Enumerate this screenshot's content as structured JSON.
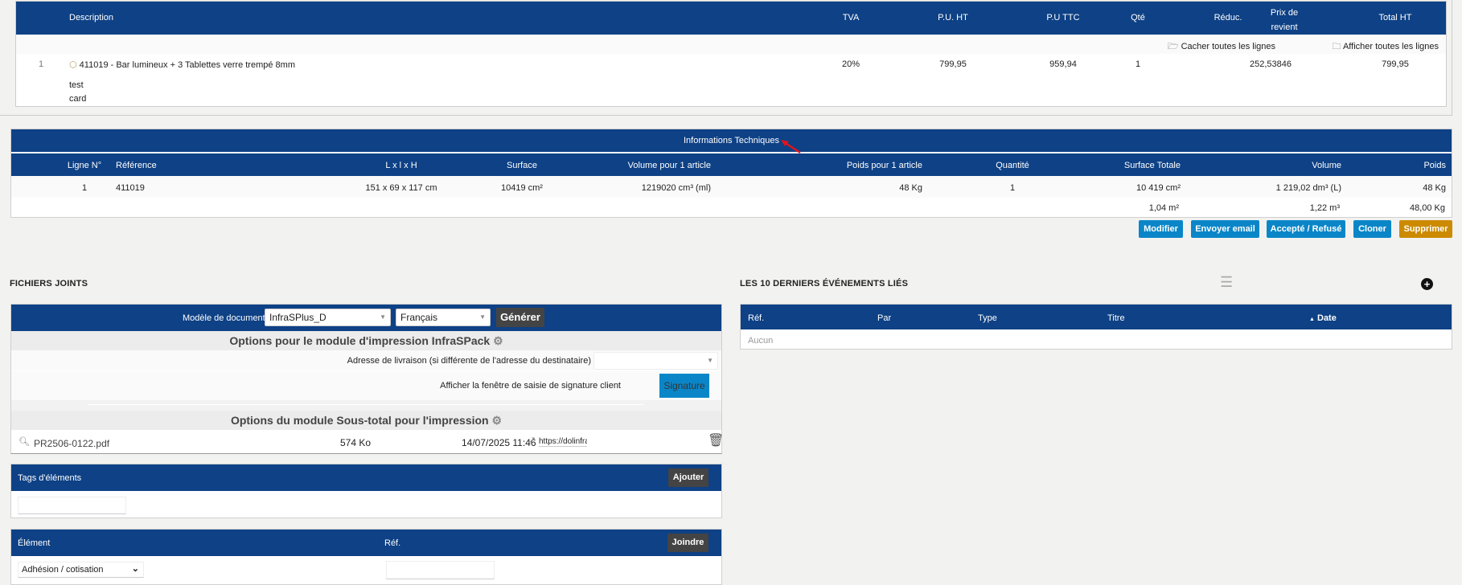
{
  "lines_table": {
    "headers": {
      "description": "Description",
      "tva": "TVA",
      "pu_ht": "P.U. HT",
      "pu_ttc": "P.U TTC",
      "qty": "Qté",
      "reduc": "Réduc.",
      "cost_price": "Prix de revient",
      "total_ht": "Total HT"
    },
    "hide_all": "Cacher toutes les lignes",
    "show_all": "Afficher toutes les lignes",
    "row": {
      "num": "1",
      "description": "411019 - Bar lumineux + 3 Tablettes verre trempé 8mm",
      "tva": "20%",
      "pu_ht": "799,95",
      "pu_ttc": "959,94",
      "qty": "1",
      "cost_price": "252,53846",
      "total_ht": "799,95",
      "note1": "test",
      "note2": "card"
    }
  },
  "tech_table": {
    "title": "Informations Techniques",
    "headers": [
      "Ligne N°",
      "Référence",
      "L x l x H",
      "Surface",
      "Volume pour 1 article",
      "Poids pour 1 article",
      "Quantité",
      "Surface Totale",
      "Volume",
      "Poids"
    ],
    "row": [
      "1",
      "411019",
      "151 x 69 x 117 cm",
      "10419 cm²",
      "1219020 cm³ (ml)",
      "48 Kg",
      "1",
      "10 419 cm²",
      "1 219,02 dm³ (L)",
      "48 Kg"
    ],
    "totals": {
      "surface": "1,04 m²",
      "volume": "1,22 m³",
      "weight": "48,00 Kg"
    }
  },
  "actions": {
    "modify": "Modifier",
    "send_email": "Envoyer email",
    "accept_refuse": "Accepté / Refusé",
    "clone": "Cloner",
    "delete": "Supprimer"
  },
  "files": {
    "section_title": "FICHIERS JOINTS",
    "model_label": "Modèle de document",
    "model_value": "InfraSPlus_D",
    "lang_value": "Français",
    "generate": "Générer",
    "options_infraspack": "Options pour le module d'impression InfraSPack",
    "delivery_label": "Adresse de livraison (si différente de l'adresse du destinataire)",
    "signature_label": "Afficher la fenêtre de saisie de signature client",
    "signature_button": "Signature",
    "options_subtotal": "Options du module Sous-total pour l'impression",
    "file": {
      "name": "PR2506-0122.pdf",
      "size": "574 Ko",
      "date": "14/07/2025 11:46",
      "link": "https://dolinfras"
    }
  },
  "tags": {
    "title": "Tags d'éléments",
    "add": "Ajouter"
  },
  "link_element": {
    "element_header": "Élément",
    "ref_header": "Réf.",
    "join": "Joindre",
    "element_value": "Adhésion / cotisation"
  },
  "events": {
    "title": "LES 10 DERNIERS ÉVÉNEMENTS LIÉS",
    "headers": {
      "ref": "Réf.",
      "by": "Par",
      "type": "Type",
      "title": "Titre",
      "date": "Date"
    },
    "empty": "Aucun"
  },
  "colors": {
    "header_blue": "#0e4185",
    "action_blue": "#0a86c8",
    "delete_orange": "#cc8a00"
  }
}
